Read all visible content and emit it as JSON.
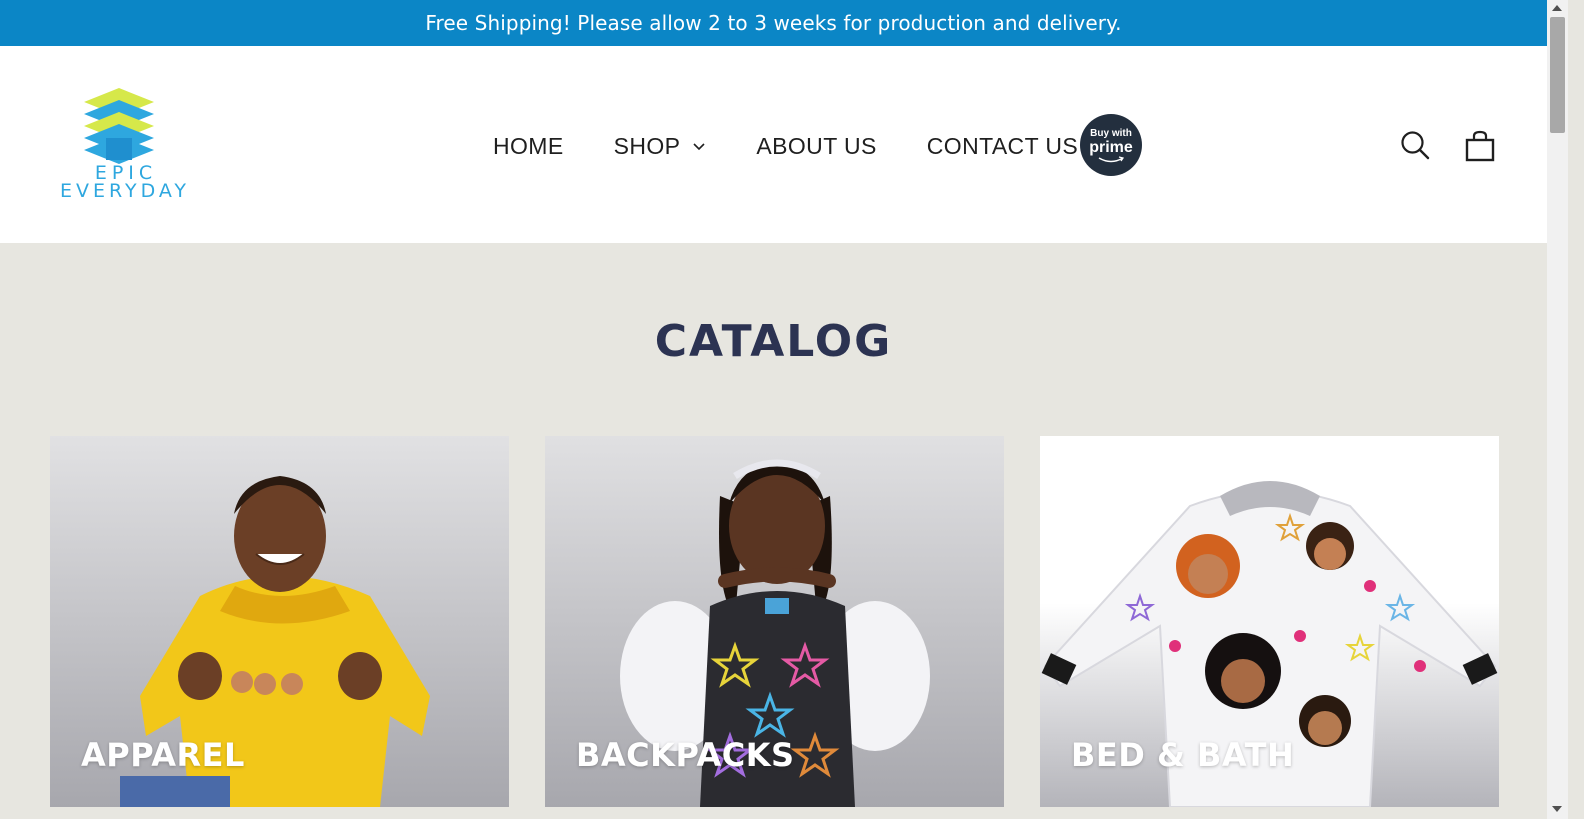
{
  "announcement": {
    "text": "Free Shipping! Please allow 2 to 3 weeks for production and delivery."
  },
  "header": {
    "logo": {
      "line1": "EPIC",
      "line2": "EVERYDAY"
    },
    "nav": [
      {
        "label": "HOME"
      },
      {
        "label": "SHOP",
        "has_dropdown": true
      },
      {
        "label": "ABOUT US"
      },
      {
        "label": "CONTACT US"
      }
    ],
    "prime_badge": {
      "line1": "Buy with",
      "line2": "prime"
    },
    "icons": {
      "search": "search-icon",
      "cart": "cart-icon"
    }
  },
  "catalog": {
    "title": "CATALOG",
    "cards": [
      {
        "label": "APPAREL"
      },
      {
        "label": "BACKPACKS"
      },
      {
        "label": "BED & BATH"
      }
    ]
  },
  "colors": {
    "announcement_bg": "#0b86c6",
    "page_bg": "#e7e6e0",
    "title": "#2c3352",
    "logo_blue": "#2ea7df",
    "logo_yellow": "#d6e84a",
    "prime_bg": "#232f3e"
  }
}
